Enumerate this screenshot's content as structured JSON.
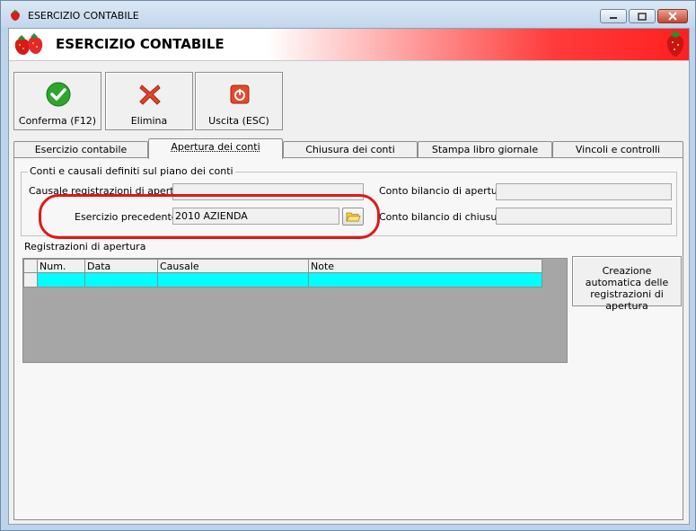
{
  "window": {
    "title": "ESERCIZIO CONTABILE",
    "icon": "strawberry-icon"
  },
  "banner": {
    "title": "ESERCIZIO CONTABILE",
    "gradient_start": "#ffffff",
    "gradient_end": "#ff2020"
  },
  "toolbar": {
    "confirm_label": "Conferma (F12)",
    "delete_label": "Elimina",
    "exit_label": "Uscita (ESC)"
  },
  "tabs": [
    {
      "label": "Esercizio contabile"
    },
    {
      "label": "Apertura dei conti"
    },
    {
      "label": "Chiusura dei conti"
    },
    {
      "label": "Stampa libro giornale"
    },
    {
      "label": "Vincoli e controlli"
    }
  ],
  "group": {
    "title": "Conti e causali definiti sul piano dei conti",
    "causale_label": "Causale registrazioni di apertura :",
    "causale_value": "",
    "esercizio_label": "Esercizio precedente :",
    "esercizio_value": "2010 AZIENDA",
    "conto_apertura_label": "Conto bilancio di apertura :",
    "conto_apertura_value": "",
    "conto_chiusura_label": "Conto bilancio di chiusura :",
    "conto_chiusura_value": ""
  },
  "registrazioni": {
    "title": "Registrazioni di apertura",
    "columns": [
      "Num.",
      "Data",
      "Causale",
      "Note"
    ],
    "row_color": "#00ffff"
  },
  "auto_button": {
    "label": "Creazione automatica delle registrazioni di apertura"
  },
  "annotation_color": "#e01818"
}
